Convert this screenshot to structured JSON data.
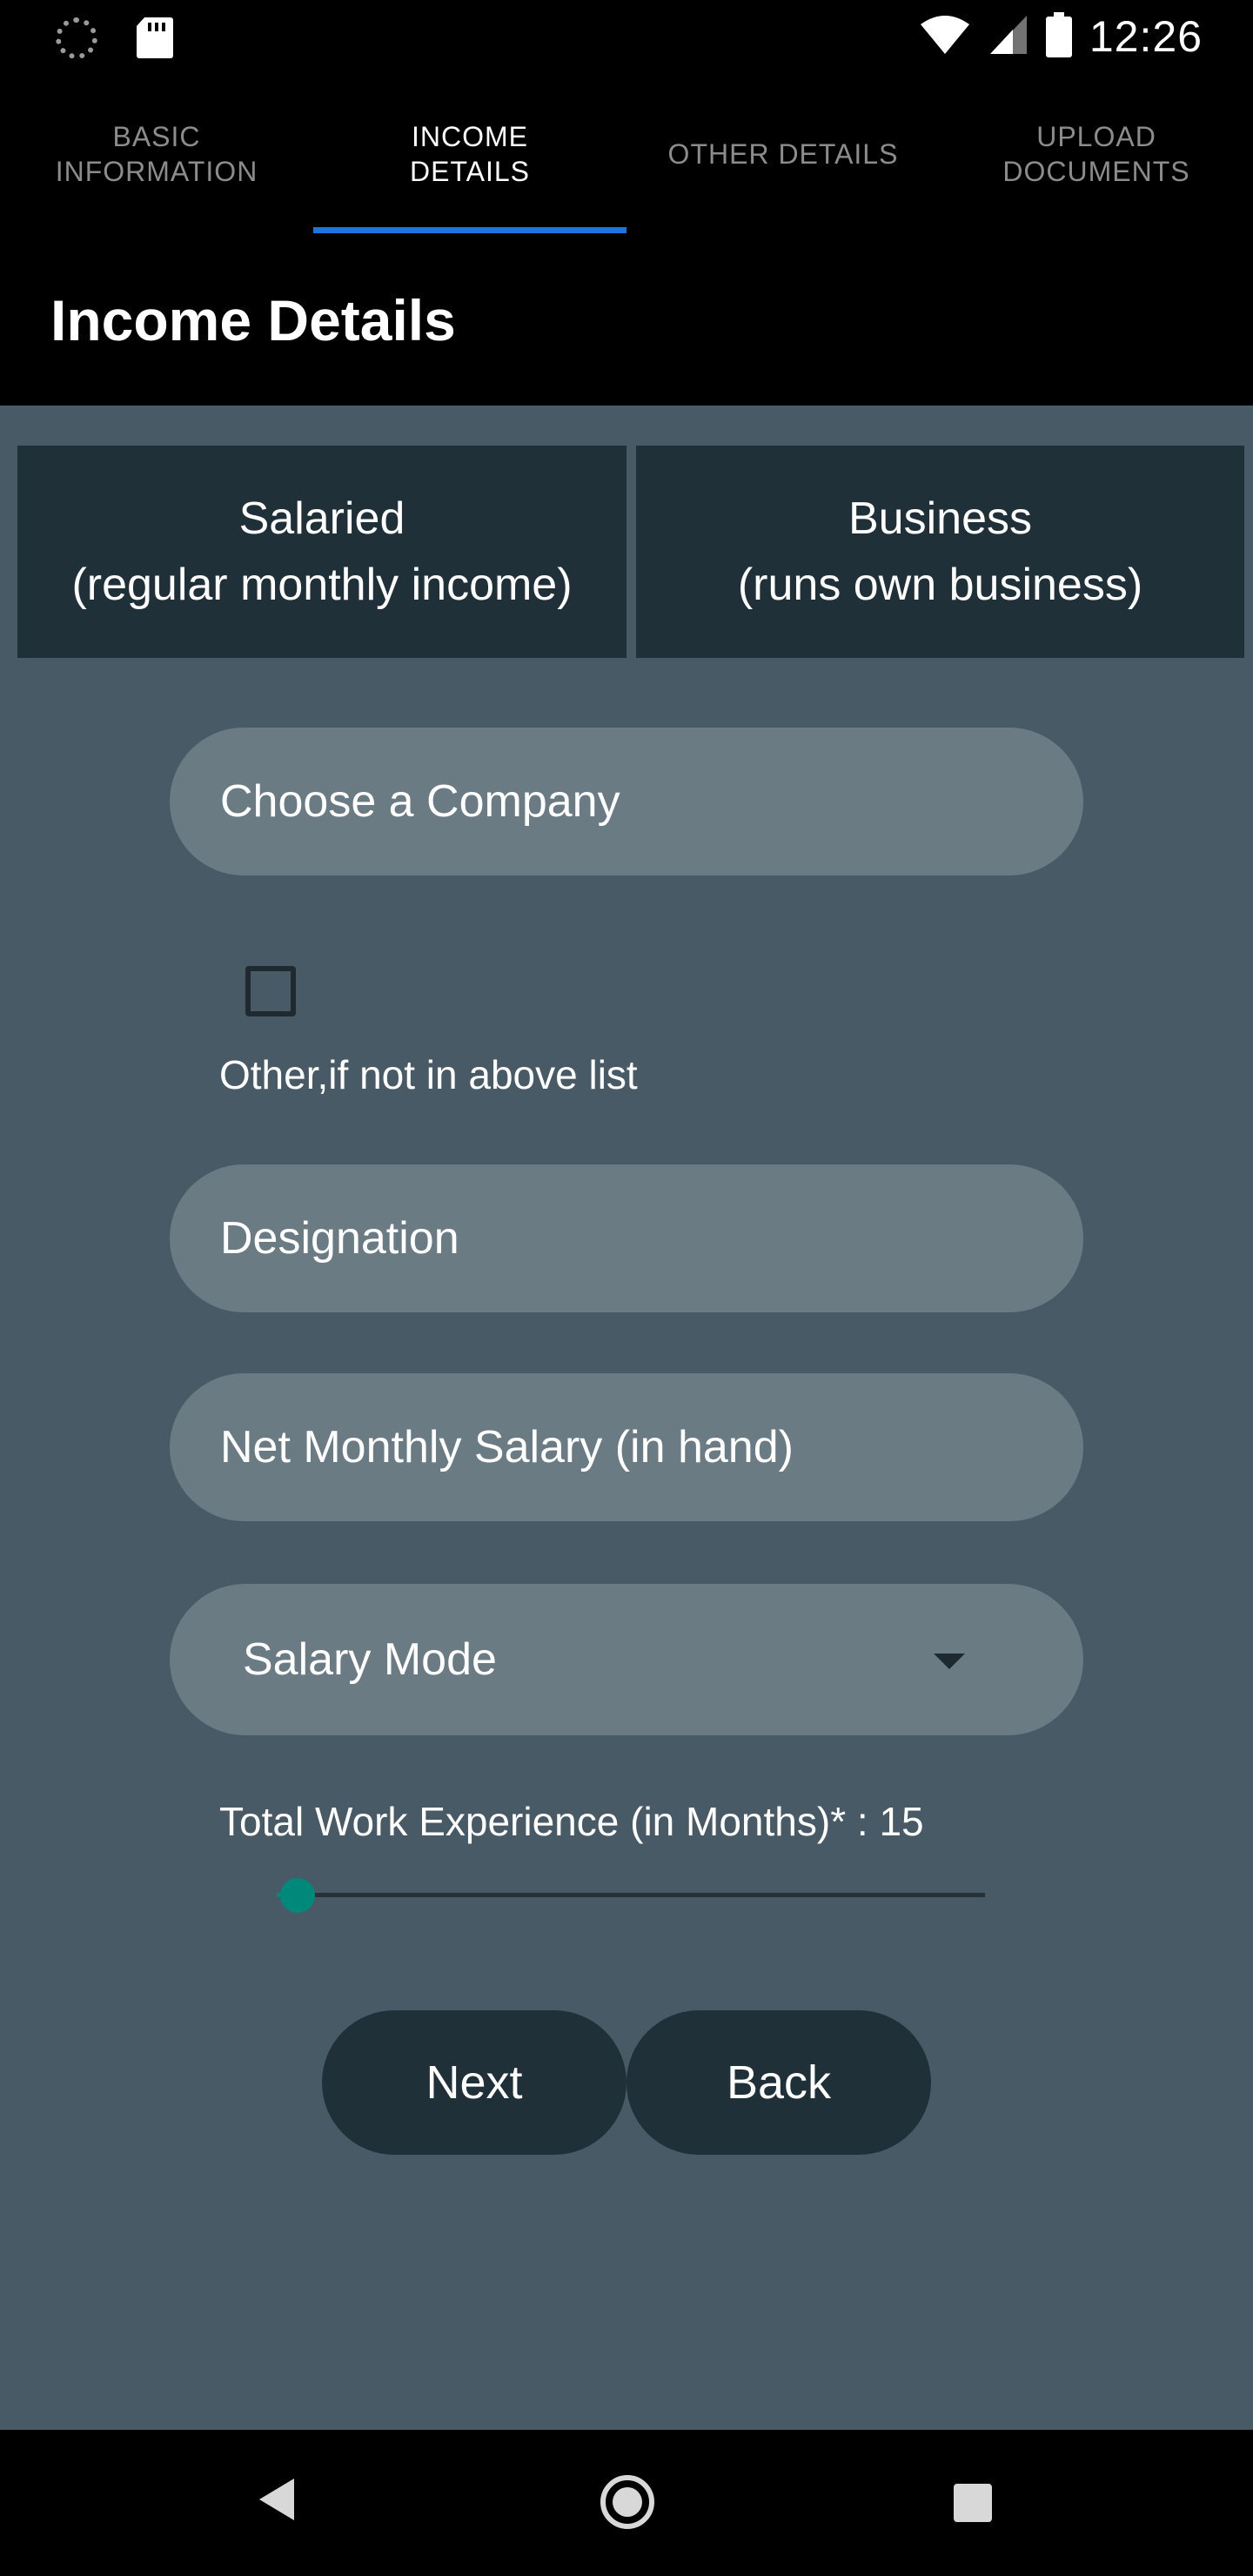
{
  "status_bar": {
    "time": "12:26",
    "icons": [
      "sync-icon",
      "sd-card-icon",
      "wifi-icon",
      "signal-icon",
      "battery-icon"
    ]
  },
  "tabs": [
    {
      "label": "BASIC\nINFORMATION",
      "active": false
    },
    {
      "label": "INCOME\nDETAILS",
      "active": true
    },
    {
      "label": "OTHER DETAILS",
      "active": false
    },
    {
      "label": "UPLOAD\nDOCUMENTS",
      "active": false
    }
  ],
  "header": {
    "title": "Income Details"
  },
  "employment_type": {
    "salaried_label": "Salaried\n(regular monthly income)",
    "business_label": "Business\n(runs own business)"
  },
  "form": {
    "company_placeholder": "Choose a Company",
    "other_checkbox_label": "Other,if not in above list",
    "other_checked": false,
    "designation_placeholder": "Designation",
    "salary_placeholder": "Net Monthly Salary (in hand)",
    "salary_mode_label": "Salary Mode",
    "experience_label": "Total Work Experience (in Months)* : 15",
    "experience_slider_fraction": 0.03
  },
  "buttons": {
    "next": "Next",
    "back": "Back"
  },
  "colors": {
    "accent_tab": "#1e74e0",
    "slider": "#00897b",
    "content_bg": "#485a66",
    "field_bg": "#6a7b84",
    "button_bg": "#1f3039"
  }
}
